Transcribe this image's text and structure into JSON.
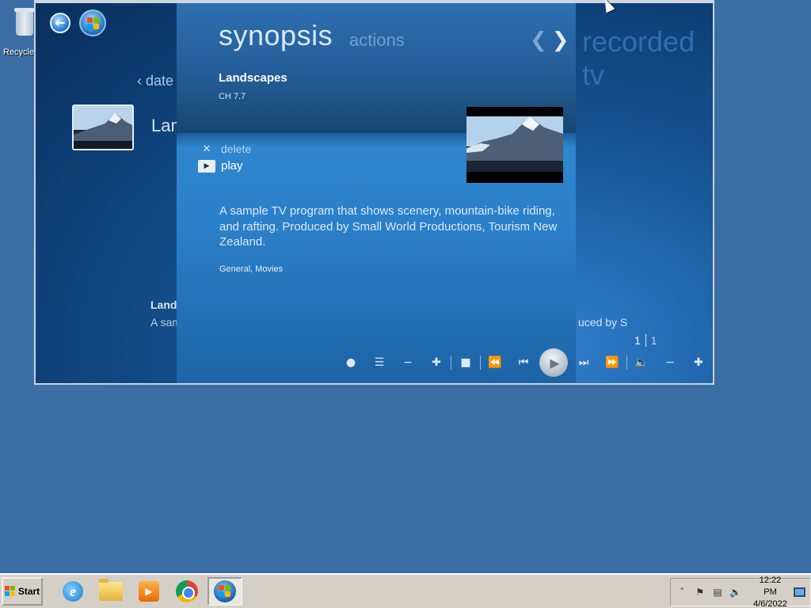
{
  "desktop": {
    "recycle_label": "Recycle Bin"
  },
  "media_center": {
    "background": {
      "breadcrumb": "date",
      "title": "Landscapes",
      "heading_right": "recorded tv",
      "bottom_title": "Landscapes",
      "bottom_desc_left": "A sample",
      "bottom_desc_right": "uced by S",
      "pager_current": "1",
      "pager_total": "1"
    },
    "panel": {
      "tab_active": "synopsis",
      "tab_inactive": "actions",
      "program_title": "Landscapes",
      "channel": "CH 7.7",
      "actions": [
        {
          "label": "delete",
          "icon": "close-icon"
        },
        {
          "label": "play",
          "icon": "play-icon"
        }
      ],
      "description": "A sample TV program that shows scenery, mountain-bike riding, and rafting. Produced by Small World Productions, Tourism New Zealand.",
      "genre": "General, Movies"
    },
    "transport": [
      "record-icon",
      "guide-icon",
      "channel-down-icon",
      "channel-up-icon",
      "stop-icon",
      "rewind-icon",
      "skip-back-icon",
      "play-icon",
      "skip-forward-icon",
      "fast-forward-icon",
      "volume-icon",
      "volume-down-icon",
      "volume-up-icon"
    ]
  },
  "taskbar": {
    "start_label": "Start",
    "clock_time": "12:22 PM",
    "clock_date": "4/6/2022"
  }
}
